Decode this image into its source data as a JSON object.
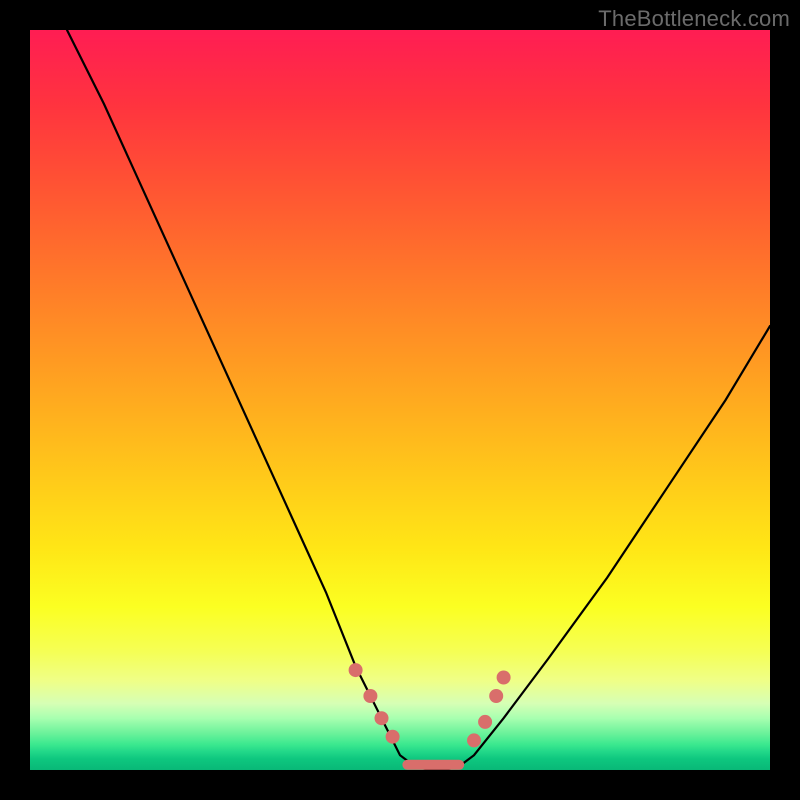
{
  "watermark": "TheBottleneck.com",
  "chart_data": {
    "type": "line",
    "title": "",
    "xlabel": "",
    "ylabel": "",
    "xlim": [
      0,
      100
    ],
    "ylim": [
      0,
      100
    ],
    "series": [
      {
        "name": "bottleneck-curve",
        "x": [
          5,
          10,
          15,
          20,
          25,
          30,
          35,
          40,
          44,
          48,
          50,
          52,
          54,
          56,
          58,
          60,
          64,
          70,
          78,
          86,
          94,
          100
        ],
        "values": [
          100,
          90,
          79,
          68,
          57,
          46,
          35,
          24,
          14,
          6,
          2,
          0.5,
          0,
          0,
          0.5,
          2,
          7,
          15,
          26,
          38,
          50,
          60
        ]
      }
    ],
    "markers": [
      {
        "x": 44.0,
        "y": 13.5
      },
      {
        "x": 46.0,
        "y": 10.0
      },
      {
        "x": 47.5,
        "y": 7.0
      },
      {
        "x": 49.0,
        "y": 4.5
      },
      {
        "x": 60.0,
        "y": 4.0
      },
      {
        "x": 61.5,
        "y": 6.5
      },
      {
        "x": 63.0,
        "y": 10.0
      },
      {
        "x": 64.0,
        "y": 12.5
      }
    ],
    "flat_segment": {
      "x_start": 51,
      "x_end": 58,
      "y": 0.7
    },
    "colors": {
      "curve": "#000000",
      "marker": "#d96e6b"
    }
  }
}
